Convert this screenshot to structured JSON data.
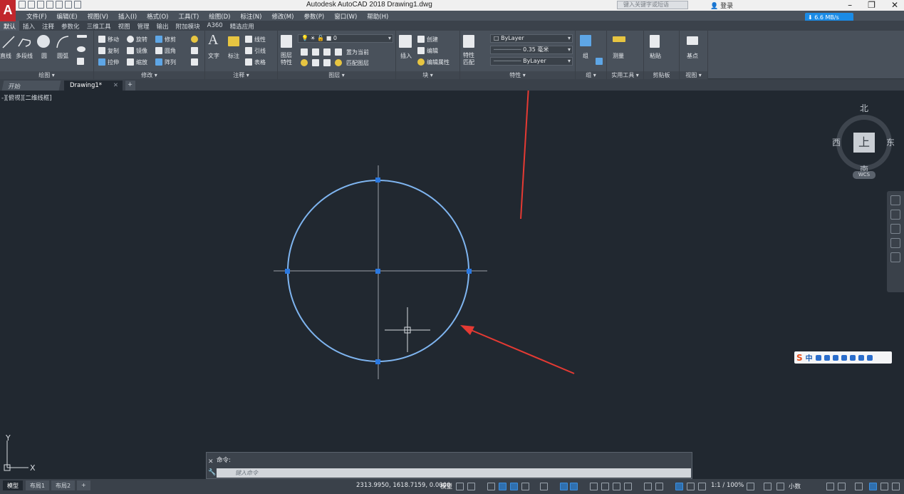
{
  "app": {
    "logo_letter": "A",
    "title": "Autodesk AutoCAD 2018    Drawing1.dwg",
    "search_placeholder": "键入关键字或短语",
    "login_label": "登录",
    "net_speed": "6.6 MB/s"
  },
  "menu": [
    "文件(F)",
    "编辑(E)",
    "视图(V)",
    "插入(I)",
    "格式(O)",
    "工具(T)",
    "绘图(D)",
    "标注(N)",
    "修改(M)",
    "参数(P)",
    "窗口(W)",
    "帮助(H)"
  ],
  "ribbon_tabs": [
    "默认",
    "插入",
    "注释",
    "参数化",
    "三维工具",
    "视图",
    "管理",
    "输出",
    "附加模块",
    "A360",
    "精选应用"
  ],
  "ribbon": {
    "draw": {
      "line": "直线",
      "polyline": "多段线",
      "circle": "圆",
      "arc": "圆弧",
      "label": "绘图 ▾"
    },
    "modify": {
      "move": "移动",
      "rotate": "旋转",
      "trim": "修剪",
      "copy": "复制",
      "mirror": "镜像",
      "fillet": "圆角",
      "stretch": "拉伸",
      "scale": "缩放",
      "array": "阵列",
      "label": "修改 ▾"
    },
    "annotation": {
      "text": "文字",
      "dimension": "标注",
      "linear": "线性",
      "leader": "引线",
      "table": "表格",
      "label": "注释 ▾"
    },
    "layers": {
      "layer_props": "图层特性",
      "current_layer": "0",
      "make_current": "置为当前",
      "match_layer": "匹配图层",
      "label": "图层 ▾"
    },
    "block": {
      "insert": "插入",
      "create": "创建",
      "edit": "编辑",
      "edit_attr": "编辑属性",
      "label": "块 ▾"
    },
    "properties": {
      "match": "特性匹配",
      "color": "ByLayer",
      "lineweight": "0.35 毫米",
      "linetype": "ByLayer",
      "label": "特性 ▾"
    },
    "groups": {
      "group": "组",
      "label": "组 ▾"
    },
    "utilities": {
      "measure": "测量",
      "label": "实用工具 ▾"
    },
    "clipboard": {
      "paste": "粘贴",
      "label": "剪贴板"
    },
    "view": {
      "base": "基点",
      "label": "视图 ▾"
    }
  },
  "doc_tabs": {
    "start": "开始",
    "drawing": "Drawing1*",
    "plus": "+"
  },
  "viewport_label": "-][俯视][二维线框]",
  "viewcube": {
    "north": "北",
    "south": "南",
    "east": "东",
    "west": "西",
    "face": "上",
    "wcs": "WCS"
  },
  "ucs": {
    "x": "X",
    "y": "Y"
  },
  "ime": {
    "s": "S",
    "zh": "中"
  },
  "command": {
    "history": "命令:",
    "placeholder": "键入命令",
    "close": "✕",
    "tool": "🔧"
  },
  "layouts": [
    "模型",
    "布局1",
    "布局2",
    "+"
  ],
  "status": {
    "coords": "2313.9950, 1618.7159, 0.0000",
    "model": "模型",
    "scale": "1:1 / 100%",
    "units": "小数"
  },
  "colors": {
    "circle": "#7fb5f0",
    "grip": "#2a78e0",
    "arrow": "#e53a33",
    "background": "#212830"
  }
}
